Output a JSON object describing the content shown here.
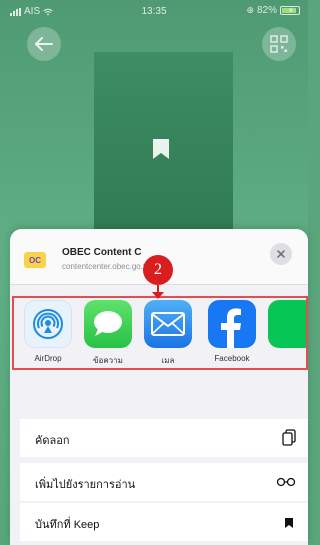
{
  "status_bar": {
    "carrier": "AIS",
    "time": "13:35",
    "battery": "82%"
  },
  "share_sheet": {
    "app_title": "OBEC Content C",
    "app_domain": "contentcenter.obec.go.th",
    "app_logo_text": "OC",
    "close_icon": "close-icon",
    "apps": [
      {
        "label": "AirDrop",
        "icon": "airdrop-icon"
      },
      {
        "label": "ข้อความ",
        "icon": "messages-icon"
      },
      {
        "label": "เมล",
        "icon": "mail-icon"
      },
      {
        "label": "Facebook",
        "icon": "facebook-icon"
      },
      {
        "label": "",
        "icon": "line-icon"
      }
    ],
    "actions": [
      {
        "label": "คัดลอก",
        "icon": "copy-icon"
      },
      {
        "label": "เพิ่มไปยังรายการอ่าน",
        "icon": "glasses-icon"
      },
      {
        "label": "บันทึกที่ Keep",
        "icon": "bookmark-icon"
      }
    ]
  },
  "annotation": {
    "step_number": "2"
  },
  "colors": {
    "accent_red": "#d81e1e",
    "background_green": "#5aa57c",
    "messages_green": "#34c759",
    "mail_blue": "#1e88e5",
    "facebook_blue": "#1877f2"
  }
}
